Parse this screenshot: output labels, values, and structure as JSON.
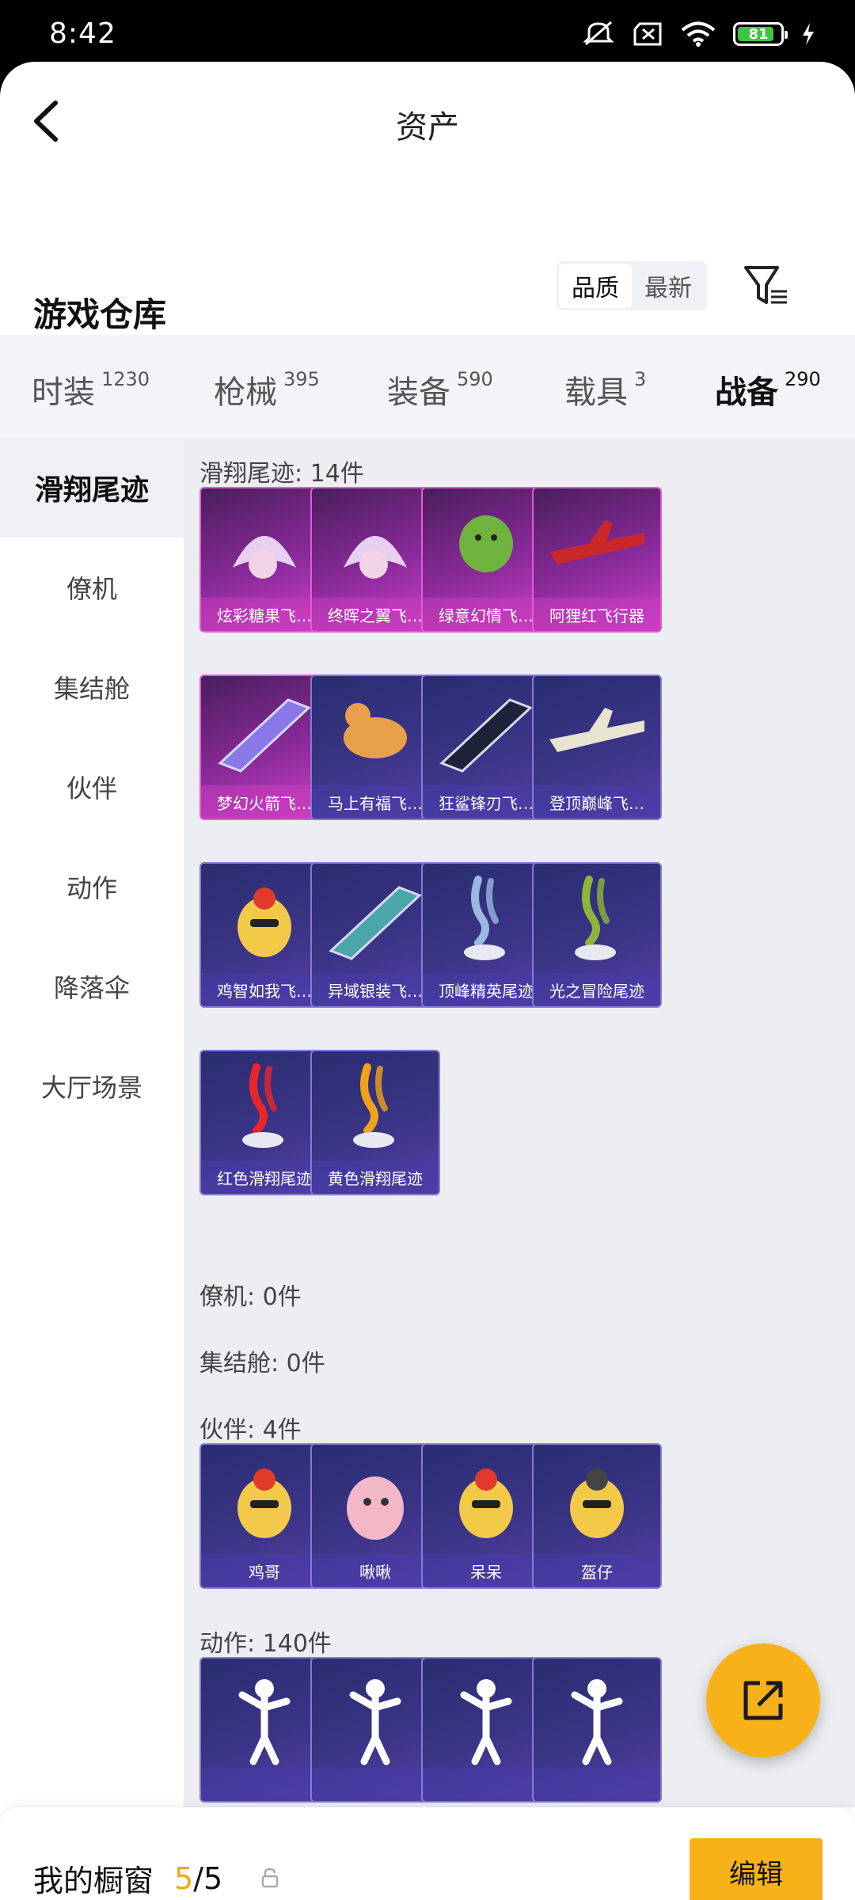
{
  "status": {
    "time": "8:42",
    "battery": "81"
  },
  "header": {
    "title": "资产"
  },
  "warehouse": {
    "title": "游戏仓库",
    "sort_quality": "品质",
    "sort_newest": "最新"
  },
  "tabs": [
    {
      "label": "时装",
      "count": "1230"
    },
    {
      "label": "枪械",
      "count": "395"
    },
    {
      "label": "装备",
      "count": "590"
    },
    {
      "label": "载具",
      "count": "3"
    },
    {
      "label": "战备",
      "count": "290",
      "active": true
    }
  ],
  "sidebar": [
    {
      "label": "滑翔尾迹",
      "active": true
    },
    {
      "label": "僚机"
    },
    {
      "label": "集结舱"
    },
    {
      "label": "伙伴"
    },
    {
      "label": "动作"
    },
    {
      "label": "降落伞"
    },
    {
      "label": "大厅场景"
    }
  ],
  "sections": [
    {
      "title": "滑翔尾迹: 14件",
      "items": [
        {
          "name": "炫彩糖果飞…",
          "rarity": "purple",
          "icon": "candy-glider-icon"
        },
        {
          "name": "终晖之翼飞…",
          "rarity": "purple",
          "icon": "wing-glider-icon"
        },
        {
          "name": "绿意幻情飞…",
          "rarity": "purple",
          "icon": "cactus-glider-icon"
        },
        {
          "name": "阿狸红飞行器",
          "rarity": "purple",
          "icon": "plane-glider-icon"
        },
        {
          "name": "梦幻火箭飞…",
          "rarity": "purple",
          "icon": "rocket-glider-icon"
        },
        {
          "name": "马上有福飞…",
          "rarity": "blue",
          "icon": "horse-glider-icon"
        },
        {
          "name": "狂鲨锋刃飞…",
          "rarity": "blue",
          "icon": "shark-glider-icon"
        },
        {
          "name": "登顶巅峰飞…",
          "rarity": "blue",
          "icon": "jet-glider-icon"
        },
        {
          "name": "鸡智如我飞…",
          "rarity": "blue",
          "icon": "chicken-glider-icon"
        },
        {
          "name": "异域银装飞…",
          "rarity": "blue",
          "icon": "blade-glider-icon"
        },
        {
          "name": "顶峰精英尾迹",
          "rarity": "blue",
          "icon": "blue-smoke-trail-icon"
        },
        {
          "name": "光之冒险尾迹",
          "rarity": "blue",
          "icon": "green-smoke-trail-icon"
        },
        {
          "name": "红色滑翔尾迹",
          "rarity": "blue",
          "icon": "red-smoke-trail-icon"
        },
        {
          "name": "黄色滑翔尾迹",
          "rarity": "blue",
          "icon": "yellow-smoke-trail-icon"
        }
      ]
    },
    {
      "title": "僚机: 0件",
      "items": []
    },
    {
      "title": "集结舱: 0件",
      "items": []
    },
    {
      "title": "伙伴: 4件",
      "items": [
        {
          "name": "鸡哥",
          "rarity": "blue",
          "icon": "chicken-partner-icon"
        },
        {
          "name": "啾啾",
          "rarity": "blue",
          "icon": "pink-bird-partner-icon"
        },
        {
          "name": "呆呆",
          "rarity": "blue",
          "icon": "chick-partner-icon"
        },
        {
          "name": "盔仔",
          "rarity": "blue",
          "icon": "helmet-chick-partner-icon"
        }
      ]
    },
    {
      "title": "动作: 140件",
      "items": [
        {
          "name": "",
          "rarity": "blue",
          "icon": "dance-action-icon"
        },
        {
          "name": "",
          "rarity": "blue",
          "icon": "dance-action-icon"
        },
        {
          "name": "",
          "rarity": "blue",
          "icon": "dance-action-icon"
        },
        {
          "name": "",
          "rarity": "blue",
          "icon": "dance-action-icon"
        }
      ]
    }
  ],
  "bottom": {
    "label": "我的橱窗",
    "current": "5",
    "total": "/5",
    "edit": "编辑"
  },
  "colors": {
    "accent": "#f7b21a",
    "purple_card": "#d042c8",
    "blue_card": "#3a3486"
  }
}
